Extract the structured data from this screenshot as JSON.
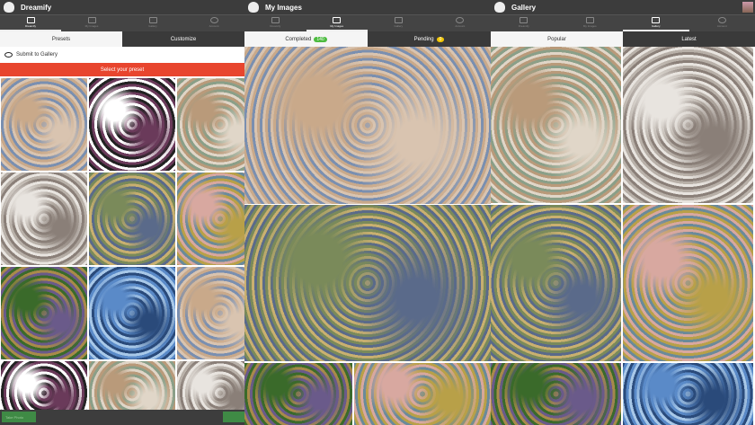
{
  "nav": [
    "Dreamify",
    "My Images",
    "Gallery",
    "Account"
  ],
  "panel1": {
    "title": "Dreamify",
    "tabs": [
      "Presets",
      "Customize"
    ],
    "submit_label": "Submit to Gallery",
    "select_banner": "Select your preset",
    "take_photo": "Take Photo"
  },
  "panel2": {
    "title": "My Images",
    "tabs": {
      "completed": "Completed",
      "completed_count": "140",
      "pending": "Pending",
      "pending_count": "0"
    }
  },
  "panel3": {
    "title": "Gallery",
    "tabs": [
      "Popular",
      "Latest"
    ]
  }
}
